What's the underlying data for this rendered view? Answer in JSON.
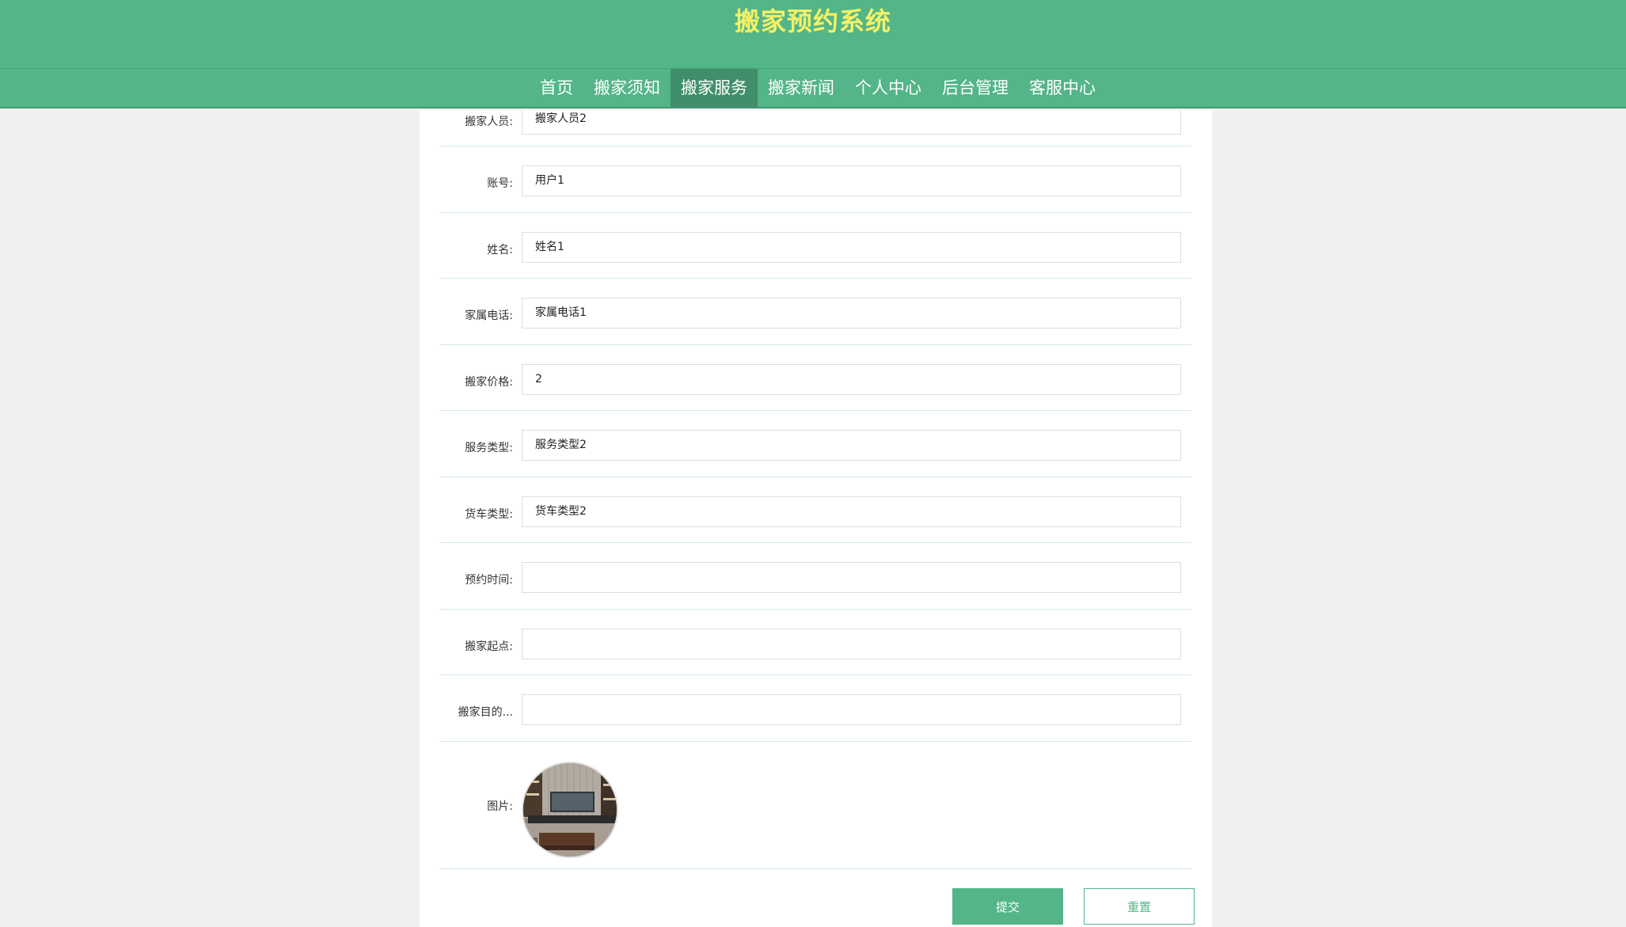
{
  "header": {
    "title": "搬家预约系统"
  },
  "nav": [
    {
      "label": "首页",
      "active": false
    },
    {
      "label": "搬家须知",
      "active": false
    },
    {
      "label": "搬家服务",
      "active": true
    },
    {
      "label": "搬家新闻",
      "active": false
    },
    {
      "label": "个人中心",
      "active": false
    },
    {
      "label": "后台管理",
      "active": false
    },
    {
      "label": "客服中心",
      "active": false
    }
  ],
  "form": {
    "fields": [
      {
        "label": "搬家人员:",
        "value": "搬家人员2"
      },
      {
        "label": "账号:",
        "value": "用户1"
      },
      {
        "label": "姓名:",
        "value": "姓名1"
      },
      {
        "label": "家属电话:",
        "value": "家属电话1"
      },
      {
        "label": "搬家价格:",
        "value": "2"
      },
      {
        "label": "服务类型:",
        "value": "服务类型2"
      },
      {
        "label": "货车类型:",
        "value": "货车类型2"
      },
      {
        "label": "预约时间:",
        "value": ""
      },
      {
        "label": "搬家起点:",
        "value": ""
      },
      {
        "label": "搬家目的...",
        "value": ""
      }
    ],
    "image_label": "图片:",
    "submit_label": "提交",
    "reset_label": "重置"
  },
  "colors": {
    "brand": "#53b588",
    "title": "#f4f166",
    "nav_active": "#3f8f6a"
  }
}
